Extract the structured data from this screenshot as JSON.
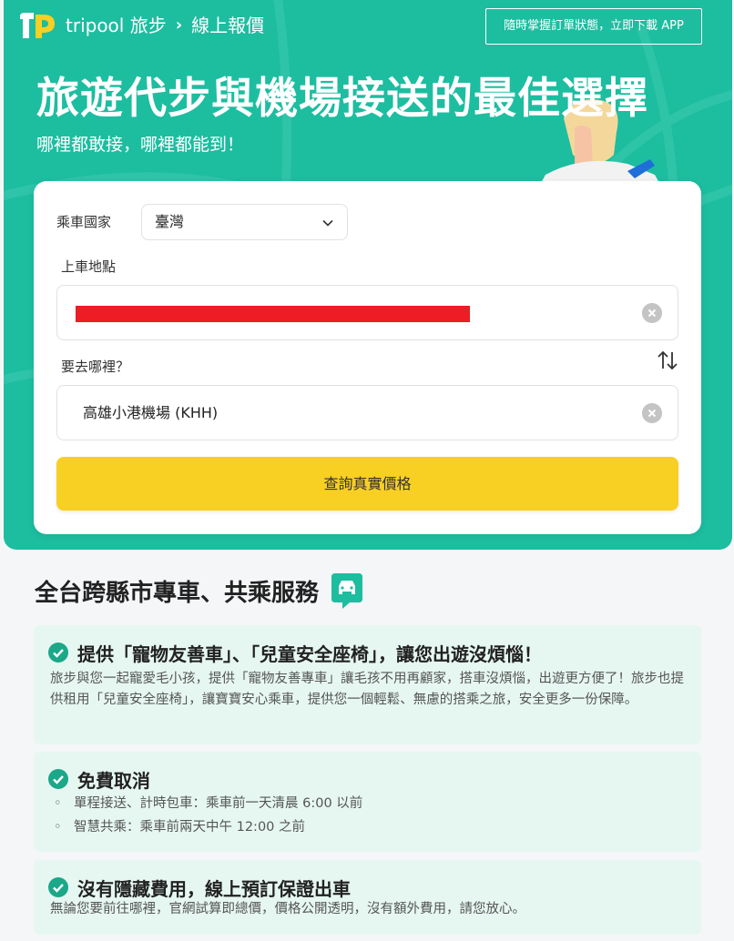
{
  "header": {
    "brand_text": "tripool 旅步",
    "separator": "›",
    "page_name": "線上報價",
    "app_button_label": "隨時掌握訂單狀態，立即下載 APP"
  },
  "hero": {
    "title": "旅遊代步與機場接送的最佳選擇",
    "subtitle": "哪裡都敢接，哪裡都能到！"
  },
  "booking_form": {
    "country_label": "乘車國家",
    "country_value": "臺灣",
    "pickup_label": "上車地點",
    "pickup_value": "",
    "destination_label": "要去哪裡？",
    "destination_value": "高雄小港機場 (KHH)",
    "submit_label": "查詢真實價格"
  },
  "services": {
    "title": "全台跨縣市專車、共乘服務",
    "features": [
      {
        "title": "提供「寵物友善車」、「兒童安全座椅」，讓您出遊沒煩惱！",
        "body": "旅步與您一起寵愛毛小孩，提供「寵物友善專車」讓毛孩不用再顧家，搭車沒煩惱，出遊更方便了！旅步也提供租用「兒童安全座椅」，讓寶寶安心乘車，提供您一個輕鬆、無慮的搭乘之旅，安全更多一份保障。"
      },
      {
        "title": "免費取消",
        "bullets": [
          "單程接送、計時包車：乘車前一天清晨 6:00 以前",
          "智慧共乘：乘車前兩天中午 12:00 之前"
        ]
      },
      {
        "title": "沒有隱藏費用，線上預訂保證出車",
        "body": "無論您要前往哪裡，官網試算即總價，價格公開透明，沒有額外費用，請您放心。"
      }
    ]
  },
  "colors": {
    "brand_teal": "#1dbda0",
    "button_yellow": "#f8cf23",
    "feature_bg": "#e6f7f1",
    "check_green": "#1aa888"
  }
}
